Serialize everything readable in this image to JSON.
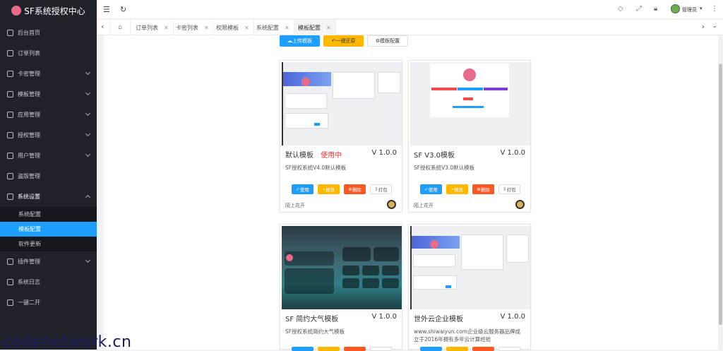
{
  "brand": {
    "title": "SF系统授权中心"
  },
  "sidebar": {
    "items": [
      {
        "label": "后台首页"
      },
      {
        "label": "订单列表"
      },
      {
        "label": "卡密管理"
      },
      {
        "label": "模板管理"
      },
      {
        "label": "应用管理"
      },
      {
        "label": "授权管理"
      },
      {
        "label": "用户管理"
      },
      {
        "label": "盗版管理"
      },
      {
        "label": "系统设置"
      },
      {
        "label": "插件管理"
      },
      {
        "label": "系统日志"
      },
      {
        "label": "一键二开"
      }
    ],
    "sub_items": [
      {
        "label": "系统配置"
      },
      {
        "label": "模板配置"
      },
      {
        "label": "软件更新"
      }
    ]
  },
  "topbar": {
    "user": "管理员"
  },
  "tabs": [
    {
      "label": "订单列表"
    },
    {
      "label": "卡密列表"
    },
    {
      "label": "权限模板"
    },
    {
      "label": "系统配置"
    },
    {
      "label": "模板配置"
    }
  ],
  "actions": {
    "upload": "上传模板",
    "restore": "一键还原",
    "config": "模板配置"
  },
  "cards": [
    {
      "title": "默认模板",
      "status": "使用中",
      "version": "V 1.0.0",
      "desc": "SF授权系统V4.0默认模板",
      "author": "陌上花开"
    },
    {
      "title": "SF V3.0模板",
      "status": "",
      "version": "V 1.0.0",
      "desc": "SF授权系统V3.0默认模板",
      "author": "陌上花开"
    },
    {
      "title": "SF 简约大气模板",
      "status": "",
      "version": "V 1.0.0",
      "desc": "SF授权系统简约大气模板",
      "author": ""
    },
    {
      "title": "世外云企业模板",
      "status": "",
      "version": "V 1.0.0",
      "desc": "www.shiwaiyun.com企业级云服务器品牌成立于2016年拥有多年云计算经验",
      "author": ""
    }
  ],
  "card_buttons": {
    "use": "使用",
    "preview": "预览",
    "delete": "删除",
    "pack": "打包"
  },
  "watermark": "codenetwork.cn",
  "colors": {
    "sidebar_bg": "#20222a",
    "accent": "#1e9fff",
    "warn": "#ffb800",
    "danger": "#ff5722"
  }
}
